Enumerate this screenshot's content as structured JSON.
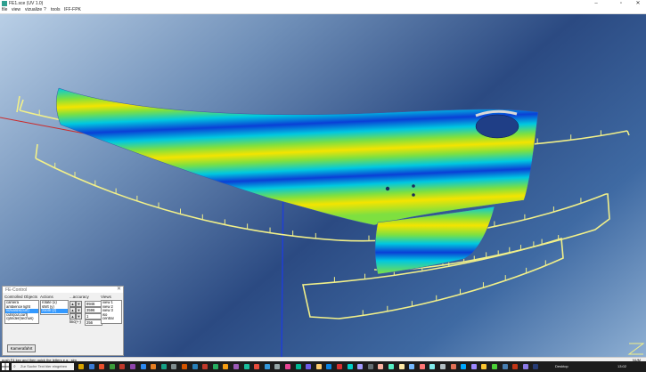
{
  "window": {
    "title": "FE1.sce (UV 1.0)",
    "minimize": "–",
    "maximize": "▫",
    "close": "✕"
  },
  "menu": [
    "file",
    "view",
    "vizualize",
    "?",
    "tools",
    "IFF-FPK"
  ],
  "panel": {
    "title": "FE-Control",
    "col_objects": "Controlled Objects",
    "col_actions": "Actions",
    "col_accuracy": "...accuracy",
    "col_views": "Views",
    "objects": [
      "camera",
      "ambience light",
      "vizualize(curf)",
      "cuts(cut,curf)",
      "cylinder(sechus)"
    ],
    "selected_object_index": 2,
    "actions": [
      "rotate (x)",
      "shift (y)",
      "zoom (z)"
    ],
    "selected_action_index": 2,
    "accuracy": [
      {
        "btn1": "▲",
        "btn2": "▼",
        "label": "",
        "value": "9946"
      },
      {
        "btn1": "▲",
        "btn2": "▼",
        "label": "",
        "value": "3596"
      },
      {
        "btn1": "▲",
        "btn2": "▼",
        "label": "",
        "value": "1"
      },
      {
        "btn1": "",
        "btn2": "",
        "label": "linc(+-)",
        "value": "256"
      }
    ],
    "views": [
      "view 1",
      "view 2",
      "view 3",
      "iso",
      "central"
    ],
    "kamera_button": "Kamerafahrt"
  },
  "status": {
    "hint": "push F4 key and then quick the letters e.g.: sim",
    "right": "NUM"
  },
  "taskbar": {
    "search_placeholder": "Zur Suche Text hier eingeben",
    "desktop": "Desktop",
    "time": "13:02",
    "icon_colors": [
      "#d9a400",
      "#3a7bd5",
      "#e8502d",
      "#3b9b3b",
      "#c0392b",
      "#8e44ad",
      "#2d89ef",
      "#e67e22",
      "#16a085",
      "#7f8c8d",
      "#d35400",
      "#2980b9",
      "#c0392b",
      "#27ae60",
      "#f39c12",
      "#9b59b6",
      "#1abc9c",
      "#e74c3c",
      "#3498db",
      "#95a5a6",
      "#e84393",
      "#00b894",
      "#6c5ce7",
      "#fdcb6e",
      "#0984e3",
      "#d63031",
      "#00cec9",
      "#a29bfe",
      "#636e72",
      "#fab1a0",
      "#55efc4",
      "#ffeaa7",
      "#74b9ff",
      "#ff7675",
      "#81ecec",
      "#b2bec3",
      "#e17055",
      "#00a8ff",
      "#9c88ff",
      "#fbc531",
      "#4cd137",
      "#487eb0",
      "#c23616",
      "#8c7ae6",
      "#273c75"
    ]
  },
  "colors": {
    "wire": "#f2f089",
    "axis_blue": "#1f3fd6",
    "axis_red": "#cc2a2a"
  }
}
